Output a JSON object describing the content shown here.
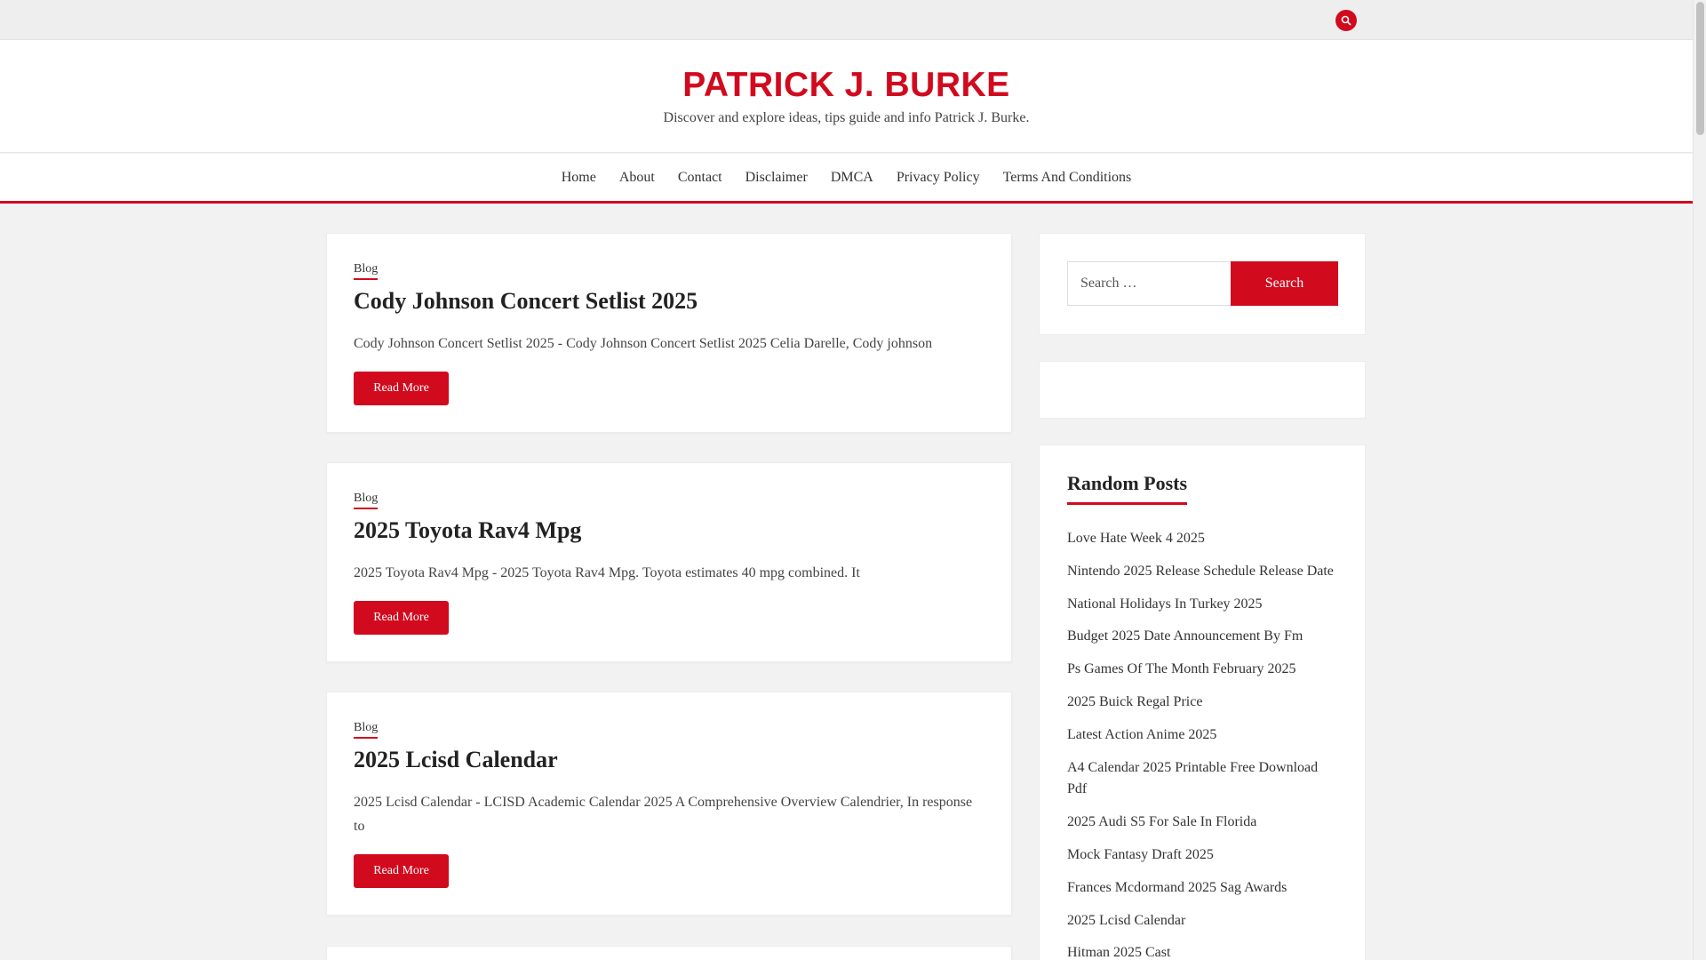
{
  "colors": {
    "accent": "#d10a1e",
    "background": "#f2f2f2",
    "card": "#ffffff"
  },
  "topbar": {
    "search_icon": "search-icon"
  },
  "header": {
    "site_title": "PATRICK J. BURKE",
    "site_description": "Discover and explore ideas, tips guide and info Patrick J. Burke."
  },
  "nav": {
    "items": [
      {
        "label": "Home"
      },
      {
        "label": "About"
      },
      {
        "label": "Contact"
      },
      {
        "label": "Disclaimer"
      },
      {
        "label": "DMCA"
      },
      {
        "label": "Privacy Policy"
      },
      {
        "label": "Terms And Conditions"
      }
    ]
  },
  "posts": [
    {
      "category": "Blog",
      "title": "Cody Johnson Concert Setlist 2025",
      "excerpt": "Cody Johnson Concert Setlist 2025 - Cody Johnson Concert Setlist 2025 Celia Darelle, Cody johnson",
      "read_more": "Read More"
    },
    {
      "category": "Blog",
      "title": "2025 Toyota Rav4 Mpg",
      "excerpt": "2025 Toyota Rav4 Mpg - 2025 Toyota Rav4 Mpg. Toyota estimates 40 mpg combined. It",
      "read_more": "Read More"
    },
    {
      "category": "Blog",
      "title": "2025 Lcisd Calendar",
      "excerpt": "2025 Lcisd Calendar - LCISD Academic Calendar 2025 A Comprehensive Overview Calendrier, In response to",
      "read_more": "Read More"
    }
  ],
  "sidebar": {
    "search": {
      "placeholder": "Search …",
      "button": "Search"
    },
    "random_posts": {
      "title": "Random Posts",
      "items": [
        "Love Hate Week 4 2025",
        "Nintendo 2025 Release Schedule Release Date",
        "National Holidays In Turkey 2025",
        "Budget 2025 Date Announcement By Fm",
        "Ps Games Of The Month February 2025",
        "2025 Buick Regal Price",
        "Latest Action Anime 2025",
        "A4 Calendar 2025 Printable Free Download Pdf",
        "2025 Audi S5 For Sale In Florida",
        "Mock Fantasy Draft 2025",
        "Frances Mcdormand 2025 Sag Awards",
        "2025 Lcisd Calendar",
        "Hitman 2025 Cast"
      ]
    }
  }
}
